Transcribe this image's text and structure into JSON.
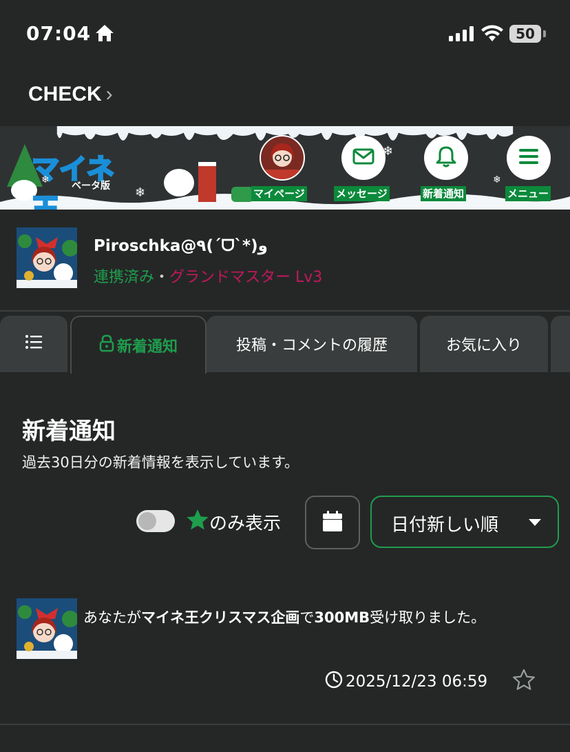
{
  "status_bar": {
    "time": "07:04",
    "battery": "50"
  },
  "back_link": {
    "label": "CHECK",
    "chevron": "›"
  },
  "banner": {
    "logo_text": "マイネ王",
    "beta_label": "ベータ版",
    "nav": [
      {
        "label": "マイページ",
        "icon": "avatar-icon"
      },
      {
        "label": "メッセージ",
        "icon": "envelope-icon"
      },
      {
        "label": "新着通知",
        "icon": "bell-icon"
      },
      {
        "label": "メニュー",
        "icon": "hamburger-icon"
      }
    ],
    "colors": {
      "nav_label_bg": "#0b8a3b",
      "logo_outline": "#1a8fd8"
    }
  },
  "profile": {
    "name": "Piroschka@٩(´ᗜ`*)و",
    "linked": "連携済み",
    "separator": "・",
    "rank": "グランドマスター Lv3",
    "colors": {
      "linked": "#1f9d4d",
      "rank": "#c2185b"
    }
  },
  "tabs": [
    {
      "label": "",
      "icon": "list-icon",
      "active": false
    },
    {
      "label": "新着通知",
      "icon": "lock-icon",
      "active": true
    },
    {
      "label": "投稿・コメントの履歴",
      "active": false
    },
    {
      "label": "お気に入り",
      "active": false
    }
  ],
  "section": {
    "title": "新着通知",
    "description": "過去30日分の新着情報を表示しています。"
  },
  "filters": {
    "star_only_label": "のみ表示",
    "star_only_checked": false,
    "calendar_icon": "calendar-icon",
    "sort_selected": "日付新しい順"
  },
  "notifications": [
    {
      "parts": [
        {
          "text": "あなたが",
          "bold": false
        },
        {
          "text": "マイネ王クリスマス企画",
          "bold": true
        },
        {
          "text": "で",
          "bold": false
        },
        {
          "text": "300MB",
          "bold": true
        },
        {
          "text": "受け取りました。",
          "bold": false
        }
      ],
      "datetime": "2025/12/23 06:59",
      "starred": false
    }
  ],
  "accent_color": "#1f9d4d"
}
